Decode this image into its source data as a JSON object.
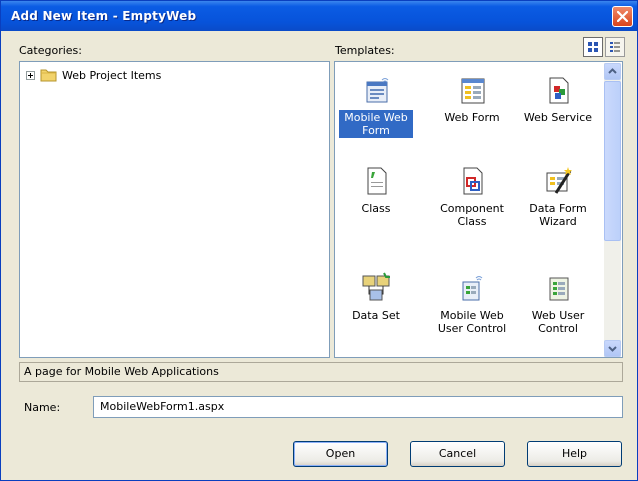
{
  "window": {
    "title": "Add New Item - EmptyWeb"
  },
  "categories": {
    "label": "Categories:",
    "items": [
      {
        "label": "Web Project Items"
      }
    ]
  },
  "templates": {
    "label": "Templates:",
    "items": [
      {
        "label": "Mobile Web Form",
        "icon": "mobile-web-form-icon",
        "selected": true
      },
      {
        "label": "Web Form",
        "icon": "web-form-icon"
      },
      {
        "label": "Web Service",
        "icon": "web-service-icon"
      },
      {
        "label": "Class",
        "icon": "class-icon"
      },
      {
        "label": "Component Class",
        "icon": "component-class-icon"
      },
      {
        "label": "Data Form Wizard",
        "icon": "data-form-wizard-icon"
      },
      {
        "label": "Data Set",
        "icon": "data-set-icon"
      },
      {
        "label": "Mobile Web User Control",
        "icon": "mobile-web-user-control-icon"
      },
      {
        "label": "Web User Control",
        "icon": "web-user-control-icon"
      }
    ]
  },
  "description": "A page for Mobile Web Applications",
  "name_field": {
    "label": "Name:",
    "value": "MobileWebForm1.aspx"
  },
  "buttons": {
    "open": "Open",
    "cancel": "Cancel",
    "help": "Help"
  }
}
